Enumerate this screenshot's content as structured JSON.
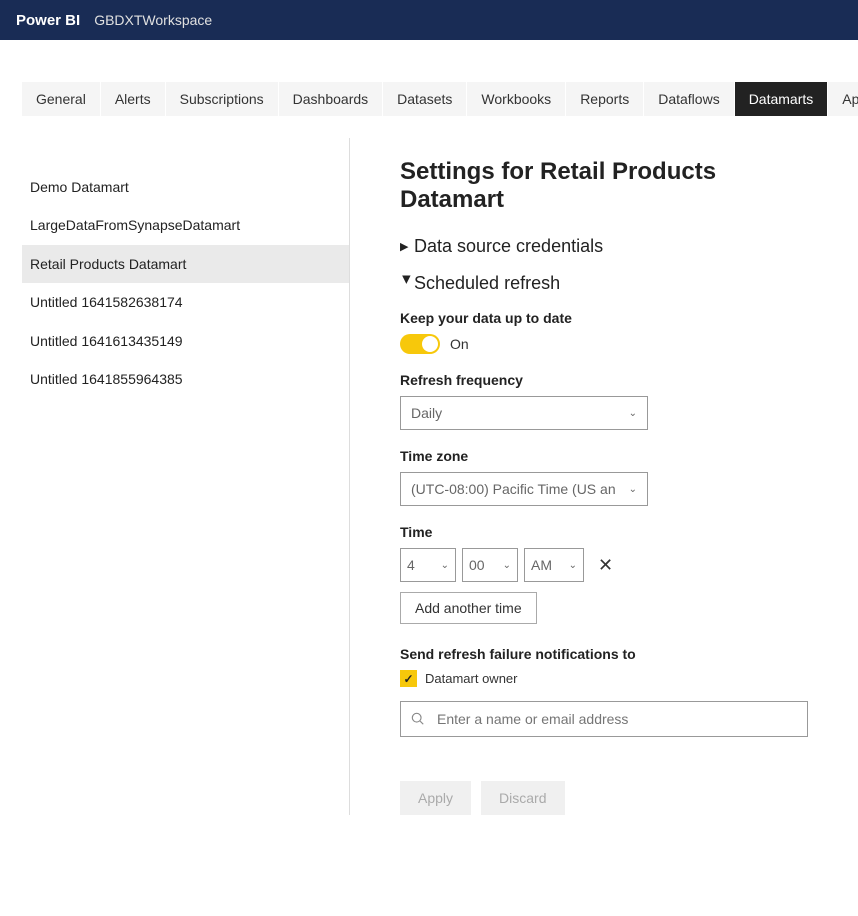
{
  "header": {
    "brand": "Power BI",
    "workspace": "GBDXTWorkspace"
  },
  "tabs": [
    {
      "label": "General",
      "active": false
    },
    {
      "label": "Alerts",
      "active": false
    },
    {
      "label": "Subscriptions",
      "active": false
    },
    {
      "label": "Dashboards",
      "active": false
    },
    {
      "label": "Datasets",
      "active": false
    },
    {
      "label": "Workbooks",
      "active": false
    },
    {
      "label": "Reports",
      "active": false
    },
    {
      "label": "Dataflows",
      "active": false
    },
    {
      "label": "Datamarts",
      "active": true
    },
    {
      "label": "App",
      "active": false
    }
  ],
  "sidebar": {
    "items": [
      {
        "label": "Demo Datamart",
        "selected": false
      },
      {
        "label": "LargeDataFromSynapseDatamart",
        "selected": false
      },
      {
        "label": "Retail Products Datamart",
        "selected": true
      },
      {
        "label": "Untitled 1641582638174",
        "selected": false
      },
      {
        "label": "Untitled 1641613435149",
        "selected": false
      },
      {
        "label": "Untitled 1641855964385",
        "selected": false
      }
    ]
  },
  "main": {
    "title": "Settings for Retail Products Datamart",
    "sections": {
      "credentials": {
        "title": "Data source credentials",
        "expanded": false
      },
      "refresh": {
        "title": "Scheduled refresh",
        "expanded": true,
        "keep_label": "Keep your data up to date",
        "toggle_state": "On",
        "freq_label": "Refresh frequency",
        "freq_value": "Daily",
        "tz_label": "Time zone",
        "tz_value": "(UTC-08:00) Pacific Time (US an",
        "time_label": "Time",
        "time_hour": "4",
        "time_minute": "00",
        "time_ampm": "AM",
        "add_time_btn": "Add another time",
        "notify_label": "Send refresh failure notifications to",
        "notify_owner_label": "Datamart owner",
        "search_placeholder": "Enter a name or email address"
      }
    },
    "actions": {
      "apply": "Apply",
      "discard": "Discard"
    }
  }
}
